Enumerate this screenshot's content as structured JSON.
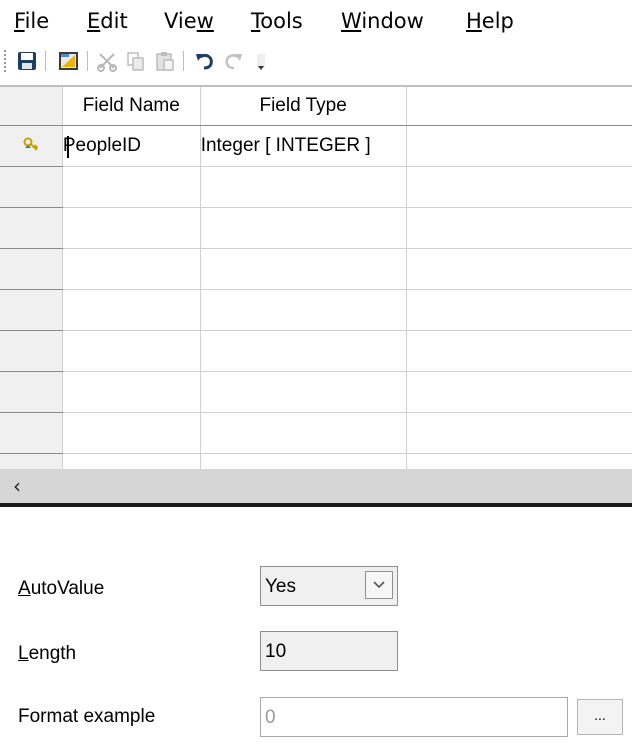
{
  "menu": {
    "items": [
      {
        "key": "file",
        "mnemonic": "F",
        "rest": "ile"
      },
      {
        "key": "edit",
        "mnemonic": "E",
        "rest": "dit"
      },
      {
        "key": "view",
        "pre": "Vie",
        "mnemonic": "w",
        "rest": ""
      },
      {
        "key": "tools",
        "mnemonic": "T",
        "rest": "ools"
      },
      {
        "key": "window",
        "mnemonic": "W",
        "rest": "indow"
      },
      {
        "key": "help",
        "mnemonic": "H",
        "rest": "elp"
      }
    ]
  },
  "toolbar": {
    "icons": [
      "save-icon",
      "index-design-icon",
      "cut-icon",
      "copy-icon",
      "paste-icon",
      "undo-icon",
      "redo-icon",
      "dropdown-arrow-icon"
    ]
  },
  "grid": {
    "headers": {
      "field_name": "Field Name",
      "field_type": "Field Type"
    },
    "rows": [
      {
        "field_name": "PeopleID",
        "field_type": "Integer [ INTEGER ]",
        "primary_key": true
      }
    ],
    "key_color": "#c8a000"
  },
  "properties": {
    "autovalue": {
      "label_mnemonic": "A",
      "label_rest": "utoValue",
      "value": "Yes"
    },
    "length": {
      "label_mnemonic": "L",
      "label_rest": "ength",
      "value": "10"
    },
    "format_example": {
      "label": "Format example",
      "value": "0"
    },
    "browse_label": "..."
  }
}
